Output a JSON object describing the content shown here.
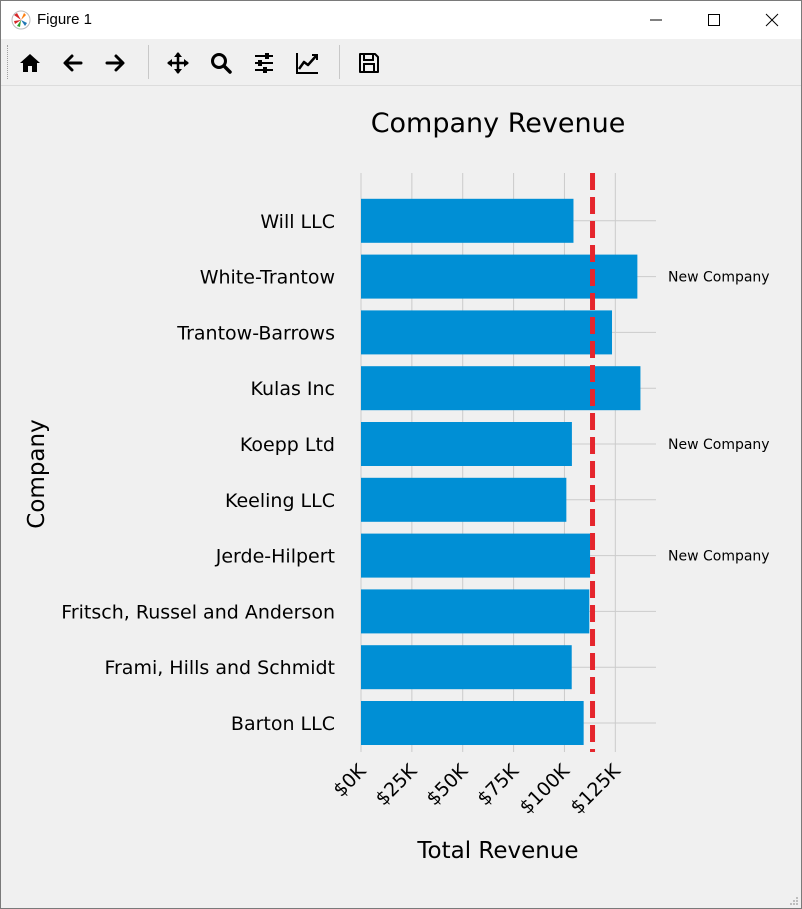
{
  "window": {
    "title": "Figure 1",
    "controls": [
      "minimize-icon",
      "maximize-icon",
      "close-icon"
    ]
  },
  "toolbar": {
    "buttons": [
      {
        "name": "home-button",
        "icon": "home-icon"
      },
      {
        "name": "back-button",
        "icon": "arrow-left-icon"
      },
      {
        "name": "forward-button",
        "icon": "arrow-right-icon"
      },
      {
        "name": "pan-button",
        "icon": "move-icon"
      },
      {
        "name": "zoom-button",
        "icon": "magnifier-icon"
      },
      {
        "name": "configure-subplots-button",
        "icon": "sliders-icon"
      },
      {
        "name": "edit-axis-button",
        "icon": "line-chart-icon"
      },
      {
        "name": "save-button",
        "icon": "floppy-disk-icon"
      }
    ]
  },
  "chart_data": {
    "type": "bar",
    "orientation": "horizontal",
    "title": "Company Revenue",
    "xlabel": "Total Revenue",
    "ylabel": "Company",
    "categories": [
      "Barton LLC",
      "Frami, Hills and Schmidt",
      "Fritsch, Russel and Anderson",
      "Jerde-Hilpert",
      "Keeling LLC",
      "Koepp Ltd",
      "Kulas Inc",
      "Trantow-Barrows",
      "White-Trantow",
      "Will LLC"
    ],
    "values": [
      109438.5,
      103569.59,
      112214.71,
      112591.43,
      100934.3,
      103660.54,
      137351.96,
      123381.38,
      135841.99,
      104437.6
    ],
    "bar_color": "#008fd5",
    "xticks": [
      "$0K",
      "$25K",
      "$50K",
      "$75K",
      "$100K",
      "$125K"
    ],
    "xtick_values": [
      0,
      25000,
      50000,
      75000,
      100000,
      125000
    ],
    "xlim": [
      0,
      145000
    ],
    "mean_line": {
      "value": 113799.1,
      "color": "#e5262d",
      "style": "dashed"
    },
    "annotations": [
      {
        "category": "Jerde-Hilpert",
        "text": "New Company"
      },
      {
        "category": "Koepp Ltd",
        "text": "New Company"
      },
      {
        "category": "White-Trantow",
        "text": "New Company"
      }
    ],
    "grid": true,
    "style": "fivethirtyeight"
  }
}
